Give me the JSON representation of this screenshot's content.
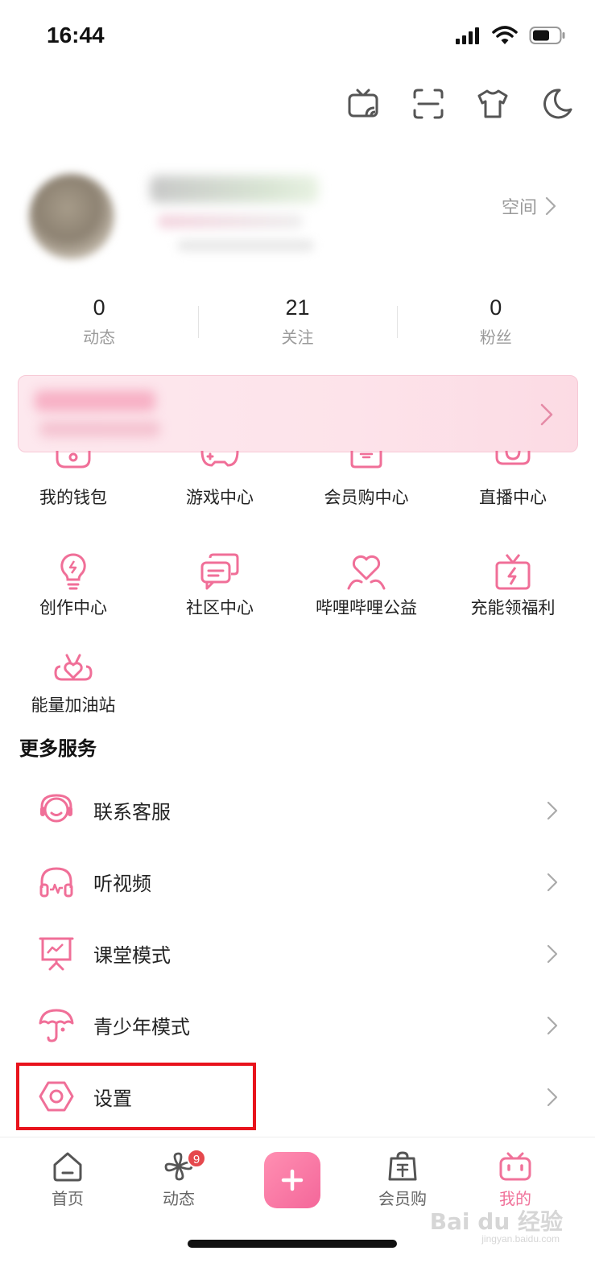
{
  "status": {
    "time": "16:44"
  },
  "profile": {
    "space_label": "空间"
  },
  "stats": [
    {
      "value": "0",
      "label": "动态"
    },
    {
      "value": "21",
      "label": "关注"
    },
    {
      "value": "0",
      "label": "粉丝"
    }
  ],
  "services": [
    {
      "label": "我的钱包",
      "icon": "wallet-icon"
    },
    {
      "label": "游戏中心",
      "icon": "gamepad-icon"
    },
    {
      "label": "会员购中心",
      "icon": "shopping-bag-icon"
    },
    {
      "label": "直播中心",
      "icon": "live-tv-icon"
    },
    {
      "label": "创作中心",
      "icon": "lightbulb-icon"
    },
    {
      "label": "社区中心",
      "icon": "chat-bubbles-icon"
    },
    {
      "label": "哔哩哔哩公益",
      "icon": "heart-hands-icon"
    },
    {
      "label": "充能领福利",
      "icon": "gift-bolt-icon"
    },
    {
      "label": "能量加油站",
      "icon": "heart-station-icon"
    }
  ],
  "more_services": {
    "title": "更多服务",
    "items": [
      {
        "label": "联系客服",
        "icon": "customer-service-icon"
      },
      {
        "label": "听视频",
        "icon": "headphones-icon"
      },
      {
        "label": "课堂模式",
        "icon": "classroom-icon"
      },
      {
        "label": "青少年模式",
        "icon": "umbrella-icon"
      },
      {
        "label": "设置",
        "icon": "settings-icon"
      }
    ]
  },
  "tabbar": [
    {
      "label": "首页",
      "icon": "home-icon"
    },
    {
      "label": "动态",
      "icon": "pinwheel-icon",
      "badge": "9"
    },
    {
      "label": "",
      "icon": "plus-icon"
    },
    {
      "label": "会员购",
      "icon": "shopping-bag-icon"
    },
    {
      "label": "我的",
      "icon": "tv-mascot-icon",
      "active": true
    }
  ],
  "watermark": {
    "text": "Bai du 经验",
    "sub": "jingyan.baidu.com"
  },
  "colors": {
    "accent": "#f0729a",
    "highlight": "#e8131c",
    "badge": "#e5484d"
  }
}
